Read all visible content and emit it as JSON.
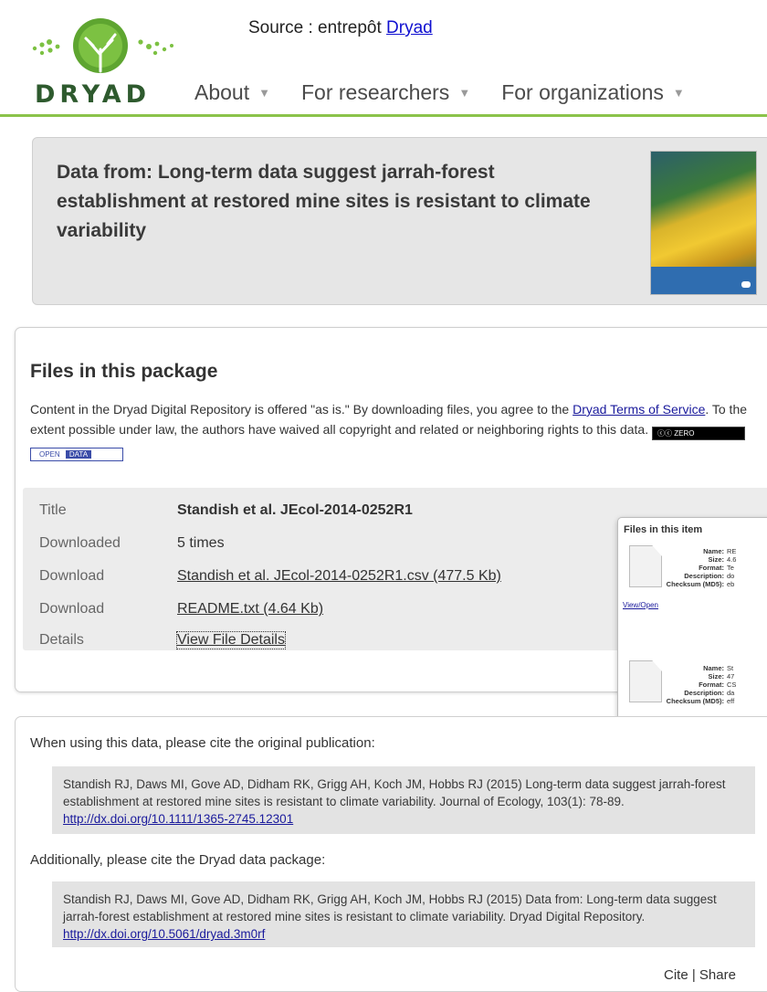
{
  "header": {
    "source_prefix": "Source : entrepôt ",
    "source_link": "Dryad",
    "logo_text": "DRYAD",
    "nav": [
      {
        "label": "About"
      },
      {
        "label": "For researchers"
      },
      {
        "label": "For organizations"
      }
    ]
  },
  "dataset": {
    "title": "Data from: Long-term data suggest jarrah-forest establishment at restored mine sites is resistant to climate variability"
  },
  "files": {
    "heading": "Files in this package",
    "desc_1": "Content in the Dryad Digital Repository is offered \"as is.\" By downloading files, you agree to the ",
    "desc_link1": "Dryad Terms of Service",
    "desc_2": ". To the extent possible under law, the authors have waived all copyright and related or neighboring rights to this data. ",
    "badge_zero": "ZERO",
    "badge_open_1": "OPEN",
    "badge_open_2": "DATA",
    "rows": [
      {
        "label": "Title",
        "value": "Standish et al. JEcol-2014-0252R1"
      },
      {
        "label": "Downloaded",
        "value": "5 times"
      },
      {
        "label": "Download",
        "value": "Standish et al. JEcol-2014-0252R1.csv (477.5 Kb)"
      },
      {
        "label": "Download",
        "value": "README.txt (4.64 Kb)"
      },
      {
        "label": "Details",
        "value": "View File Details"
      }
    ]
  },
  "popup": {
    "title": "Files in this item",
    "view_open": "View/Open",
    "field_labels": [
      "Name:",
      "Size:",
      "Format:",
      "Description:",
      "Checksum (MD5):"
    ],
    "file1": [
      "RE",
      "4.6",
      "Te",
      "do",
      "eb"
    ],
    "file2": [
      "St",
      "47",
      "CS",
      "da",
      "eff"
    ]
  },
  "citation": {
    "intro": "When using this data, please cite the original publication:",
    "original": "Standish RJ, Daws MI, Gove AD, Didham RK, Grigg AH, Koch JM, Hobbs RJ (2015) Long-term data suggest jarrah-forest establishment at restored mine sites is resistant to climate variability. Journal of Ecology, 103(1): 78-89. ",
    "original_link": "http://dx.doi.org/10.1111/1365-2745.12301",
    "additional": "Additionally, please cite the Dryad data package:",
    "package": "Standish RJ, Daws MI, Gove AD, Didham RK, Grigg AH, Koch JM, Hobbs RJ (2015) Data from: Long-term data suggest jarrah-forest establishment at restored mine sites is resistant to climate variability. Dryad Digital Repository. ",
    "package_link": "http://dx.doi.org/10.5061/dryad.3m0rf",
    "cite_label": "Cite",
    "share_label": "Share",
    "separator": " | "
  },
  "colors": {
    "nav_rule": "#8bc34a",
    "link": "#1a1a9c",
    "panel_gray": "#e6e6e6"
  }
}
